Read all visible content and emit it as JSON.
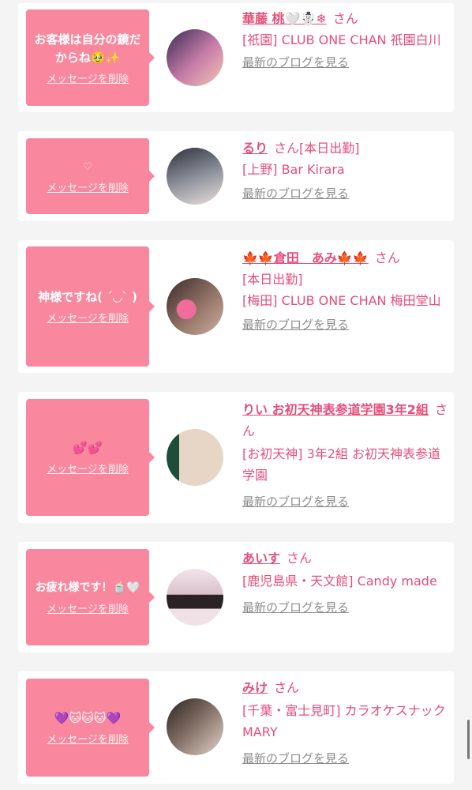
{
  "cards": [
    {
      "message": "お客様は自分の鏡だからね🥹✨",
      "delete_label": "メッセージを削除",
      "name": "華藤 桃🤍☃️❄",
      "honorific": "さん",
      "details": "[祇園] CLUB ONE CHAN 祇園白川",
      "blog_link": "最新のブログを見る"
    },
    {
      "message": "♡",
      "delete_label": "メッセージを削除",
      "name": "るり",
      "honorific": "さん[本日出勤]",
      "details": "[上野] Bar Kirara",
      "blog_link": "最新のブログを見る"
    },
    {
      "message": "神様ですね( ´◡` )",
      "delete_label": "メッセージを削除",
      "name": "🍁🍁倉田　あみ🍁🍁",
      "honorific": "さん",
      "details": "[本日出勤]\n[梅田] CLUB ONE CHAN 梅田堂山",
      "blog_link": "最新のブログを見る"
    },
    {
      "message": "💕💕",
      "delete_label": "メッセージを削除",
      "name": "りい お初天神表参道学園3年2組",
      "honorific": "さん",
      "details": "[お初天神] 3年2組 お初天神表参道学園",
      "blog_link": "最新のブログを見る"
    },
    {
      "message": "お疲れ様です！🍵🤍",
      "delete_label": "メッセージを削除",
      "name": "あいす",
      "honorific": "さん",
      "details": "[鹿児島県・天文館] Candy made",
      "blog_link": "最新のブログを見る"
    },
    {
      "message": "💜🐱🐱🐱💜",
      "delete_label": "メッセージを削除",
      "name": "みけ",
      "honorific": "さん",
      "details": "[千葉・富士見町] カラオケスナック MARY",
      "blog_link": "最新のブログを見る"
    }
  ],
  "colors": {
    "accent": "#e64e79",
    "bubble": "#f9879d",
    "link_gray": "#8c8c8c",
    "background": "#f4f4f4"
  }
}
